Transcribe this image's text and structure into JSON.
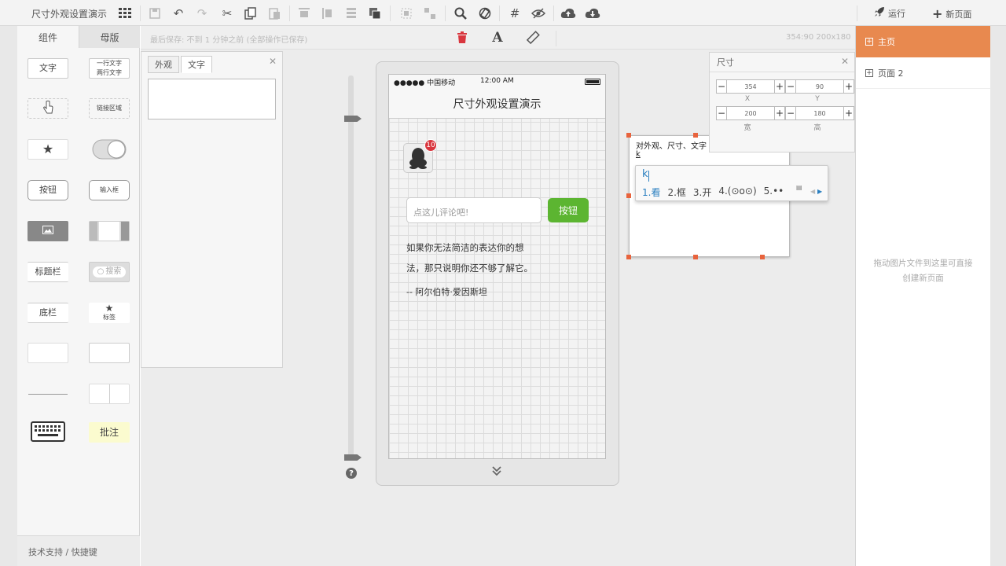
{
  "app": {
    "title": "尺寸外观设置演示"
  },
  "toolbar": {
    "run_label": "运行",
    "new_page_label": "新页面"
  },
  "palette": {
    "tabs": [
      "组件",
      "母版"
    ],
    "items": [
      "文字",
      "一行文字",
      "两行文字",
      "链接区域",
      "按钮",
      "输入框",
      "标题栏",
      "搜索",
      "底栏",
      "标签",
      "批注"
    ],
    "support": "技术支持 / 快捷键"
  },
  "canvasbar": {
    "save_info": "最后保存: 不到 1 分钟之前 (全部操作已保存)",
    "coords": "354:90 200x180"
  },
  "prop_panel": {
    "tabs": [
      "外观",
      "文字"
    ]
  },
  "phone": {
    "carrier": "●●●●● 中国移动",
    "time": "12:00 AM",
    "nav_title": "尺寸外观设置演示",
    "badge": "10",
    "comment_placeholder": "点这儿评论吧!",
    "button_label": "按钮",
    "quote_line1": "如果你无法简洁的表达你的想",
    "quote_line2": "法，那只说明你还不够了解它。",
    "quote_author": "-- 阿尔伯特·爱因斯坦"
  },
  "size_panel": {
    "title": "尺寸",
    "x": "354",
    "y": "90",
    "w": "200",
    "h": "180",
    "label_x": "X",
    "label_y": "Y",
    "label_w": "宽",
    "label_h": "高"
  },
  "text_widget": {
    "text": "对外观、尺寸、文字",
    "typed": "k"
  },
  "ime": {
    "input": "k",
    "candidates": [
      "1.看",
      "2.框",
      "3.开",
      "4.(⊙o⊙)",
      "5.••"
    ]
  },
  "pages": {
    "items": [
      "主页",
      "页面 2"
    ],
    "hint_line1": "拖动图片文件到这里可直接",
    "hint_line2": "创建新页面"
  },
  "colors": {
    "accent": "#e8894f",
    "button_green": "#5cb531",
    "badge_red": "#d9363e"
  }
}
